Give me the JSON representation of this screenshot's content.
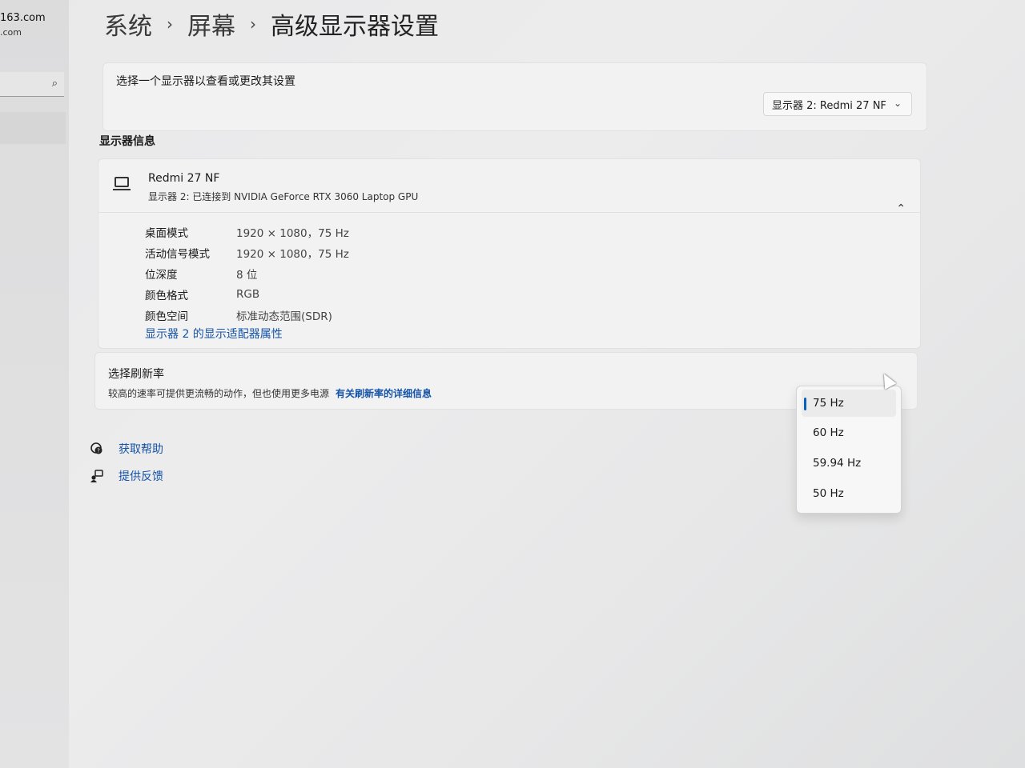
{
  "sidebar": {
    "account_line1": "163.com",
    "account_line2": ".com",
    "search_icon": "search-icon"
  },
  "breadcrumb": [
    "系统",
    "屏幕",
    "高级显示器设置"
  ],
  "display_select": {
    "label": "选择一个显示器以查看或更改其设置",
    "selected": "显示器 2: Redmi 27 NF"
  },
  "section_title": "显示器信息",
  "monitor": {
    "name": "Redmi 27 NF",
    "subtitle": "显示器 2: 已连接到 NVIDIA GeForce RTX 3060 Laptop GPU",
    "rows": [
      {
        "key": "桌面模式",
        "value": "1920 × 1080，75 Hz"
      },
      {
        "key": "活动信号模式",
        "value": "1920 × 1080，75 Hz"
      },
      {
        "key": "位深度",
        "value": "8 位"
      },
      {
        "key": "颜色格式",
        "value": "RGB"
      },
      {
        "key": "颜色空间",
        "value": "标准动态范围(SDR)"
      }
    ],
    "adapter_link": "显示器 2 的显示适配器属性"
  },
  "refresh": {
    "title": "选择刷新率",
    "description": "较高的速率可提供更流畅的动作，但也使用更多电源",
    "link": "有关刷新率的详细信息",
    "options": [
      "75 Hz",
      "60 Hz",
      "59.94 Hz",
      "50 Hz"
    ],
    "selected": "75 Hz"
  },
  "help": [
    {
      "label": "获取帮助",
      "icon": "help-icon"
    },
    {
      "label": "提供反馈",
      "icon": "feedback-icon"
    }
  ],
  "colors": {
    "accent": "#0a5fbf",
    "link": "#1553a8"
  }
}
